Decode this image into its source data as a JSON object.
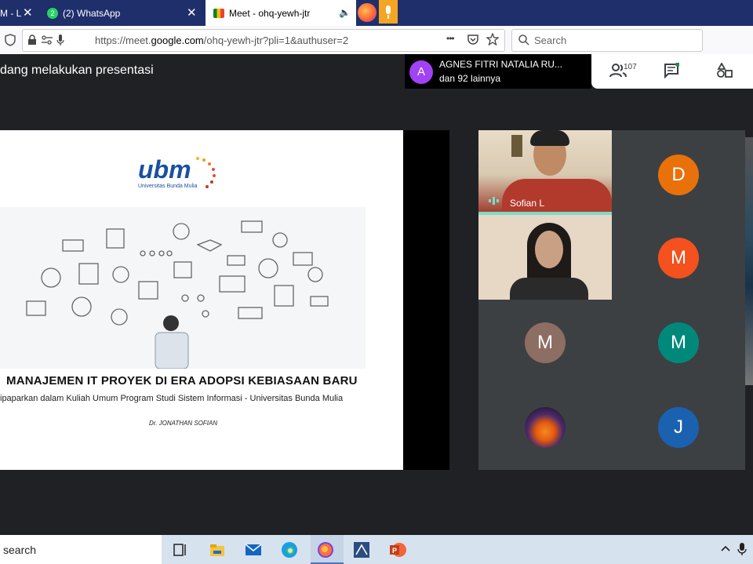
{
  "browser": {
    "tabs": [
      {
        "label": "M - L",
        "active": false
      },
      {
        "label": "(2) WhatsApp",
        "active": false
      },
      {
        "label": "Meet - ohq-yewh-jtr",
        "active": true
      }
    ],
    "url_prefix": "https://meet.",
    "url_domain": "google.com",
    "url_suffix": "/ohq-yewh-jtr?pli=1&authuser=2",
    "search_placeholder": "Search",
    "menu_glyph": "•••"
  },
  "meet": {
    "presenting_text": "dang melakukan presentasi",
    "presenter": {
      "initial": "A",
      "name": "AGNES FITRI NATALIA RU...",
      "sub": "dan 92 lainnya"
    },
    "participant_count": "107",
    "slide": {
      "logo_accent": "u",
      "logo_main": "bm",
      "logo_sub": "Universitas Bunda Mulia",
      "title": "MANAJEMEN IT PROYEK DI ERA ADOPSI KEBIASAAN BARU",
      "subtitle": "ipaparkan dalam Kuliah Umum  Program Studi Sistem Informasi - Universitas Bunda Mulia",
      "author": "Dr. JONATHAN SOFIAN"
    },
    "tiles": [
      {
        "type": "video",
        "name": "Sofian L"
      },
      {
        "type": "avatar",
        "initial": "D",
        "color": "#e8710a"
      },
      {
        "type": "video",
        "name": ""
      },
      {
        "type": "avatar",
        "initial": "M",
        "color": "#f4511e"
      },
      {
        "type": "avatar",
        "initial": "M",
        "color": "#8d6e63"
      },
      {
        "type": "avatar",
        "initial": "M",
        "color": "#00897b"
      },
      {
        "type": "avatar",
        "initial": "",
        "color": "#2b1a3c"
      },
      {
        "type": "avatar",
        "initial": "J",
        "color": "#1a62b0"
      }
    ]
  },
  "taskbar": {
    "search_label": "search"
  }
}
